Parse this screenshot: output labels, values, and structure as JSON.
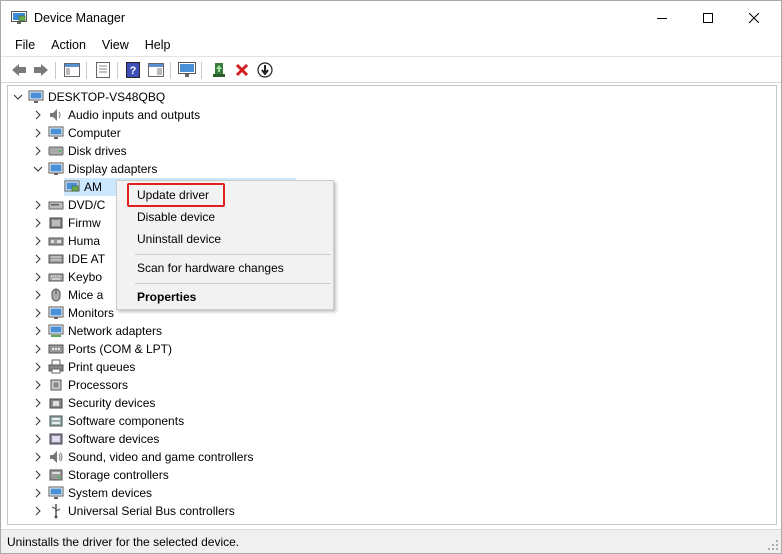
{
  "window": {
    "title": "Device Manager"
  },
  "menu": [
    "File",
    "Action",
    "View",
    "Help"
  ],
  "toolbar": {
    "buttons": [
      "back-icon",
      "forward-icon",
      "show-hide-console-tree-icon",
      "properties-icon",
      "help-icon",
      "action-pane-icon",
      "scan-hardware-icon",
      "update-driver-icon",
      "uninstall-icon",
      "disable-device-icon"
    ]
  },
  "tree": {
    "root": "DESKTOP-VS48QBQ",
    "items": [
      {
        "label": "Audio inputs and outputs",
        "icon": "speaker-icon"
      },
      {
        "label": "Computer",
        "icon": "computer-icon"
      },
      {
        "label": "Disk drives",
        "icon": "disk-icon"
      },
      {
        "label": "Display adapters",
        "icon": "display-icon",
        "expanded": true
      },
      {
        "label": "AM",
        "icon": "display-card-icon",
        "child": true,
        "selected": true
      },
      {
        "label": "DVD/C",
        "icon": "dvd-icon"
      },
      {
        "label": "Firmw",
        "icon": "firmware-icon"
      },
      {
        "label": "Huma",
        "icon": "hid-icon"
      },
      {
        "label": "IDE AT",
        "icon": "ide-icon"
      },
      {
        "label": "Keybo",
        "icon": "keyboard-icon"
      },
      {
        "label": "Mice a",
        "icon": "mouse-icon"
      },
      {
        "label": "Monitors",
        "icon": "monitor-icon"
      },
      {
        "label": "Network adapters",
        "icon": "network-icon"
      },
      {
        "label": "Ports (COM & LPT)",
        "icon": "port-icon"
      },
      {
        "label": "Print queues",
        "icon": "printer-icon"
      },
      {
        "label": "Processors",
        "icon": "processor-icon"
      },
      {
        "label": "Security devices",
        "icon": "security-icon"
      },
      {
        "label": "Software components",
        "icon": "software-component-icon"
      },
      {
        "label": "Software devices",
        "icon": "software-device-icon"
      },
      {
        "label": "Sound, video and game controllers",
        "icon": "sound-icon"
      },
      {
        "label": "Storage controllers",
        "icon": "storage-icon"
      },
      {
        "label": "System devices",
        "icon": "system-icon"
      },
      {
        "label": "Universal Serial Bus controllers",
        "icon": "usb-icon"
      }
    ]
  },
  "context_menu": {
    "items": [
      {
        "label": "Update driver",
        "highlighted": true
      },
      {
        "label": "Disable device"
      },
      {
        "label": "Uninstall device"
      },
      {
        "label": "Scan for hardware changes"
      },
      {
        "label": "Properties",
        "bold": true
      }
    ]
  },
  "status": {
    "text": "Uninstalls the driver for the selected device."
  },
  "colors": {
    "selection": "#cce8ff",
    "highlight_box": "#e0201e",
    "menu_bg": "#f2f2f2"
  }
}
